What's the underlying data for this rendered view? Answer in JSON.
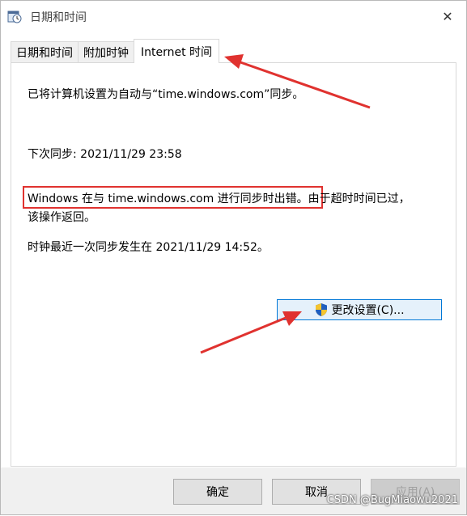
{
  "window": {
    "title": "日期和时间",
    "close_glyph": "✕"
  },
  "tabs": [
    {
      "label": "日期和时间",
      "active": false
    },
    {
      "label": "附加时钟",
      "active": false
    },
    {
      "label": "Internet 时间",
      "active": true
    }
  ],
  "internet_time": {
    "sync_setting": "已将计算机设置为自动与“time.windows.com”同步。",
    "next_sync": "下次同步: 2021/11/29 23:58",
    "error_line1": "Windows 在与 time.windows.com 进行同步时出错。由于超时时间已过，",
    "error_line2": "该操作返回。",
    "last_sync": "时钟最近一次同步发生在 2021/11/29 14:52。",
    "change_settings_label": "更改设置(C)..."
  },
  "buttons": {
    "ok": "确定",
    "cancel": "取消",
    "apply": "应用(A)"
  },
  "watermark": "CSDN @BugMiaowu2021",
  "colors": {
    "annotation_red": "#e0322f",
    "accent_blue": "#0078d7"
  },
  "icons": {
    "title": "clock-calendar-icon",
    "close": "close-icon",
    "shield": "uac-shield-icon"
  }
}
